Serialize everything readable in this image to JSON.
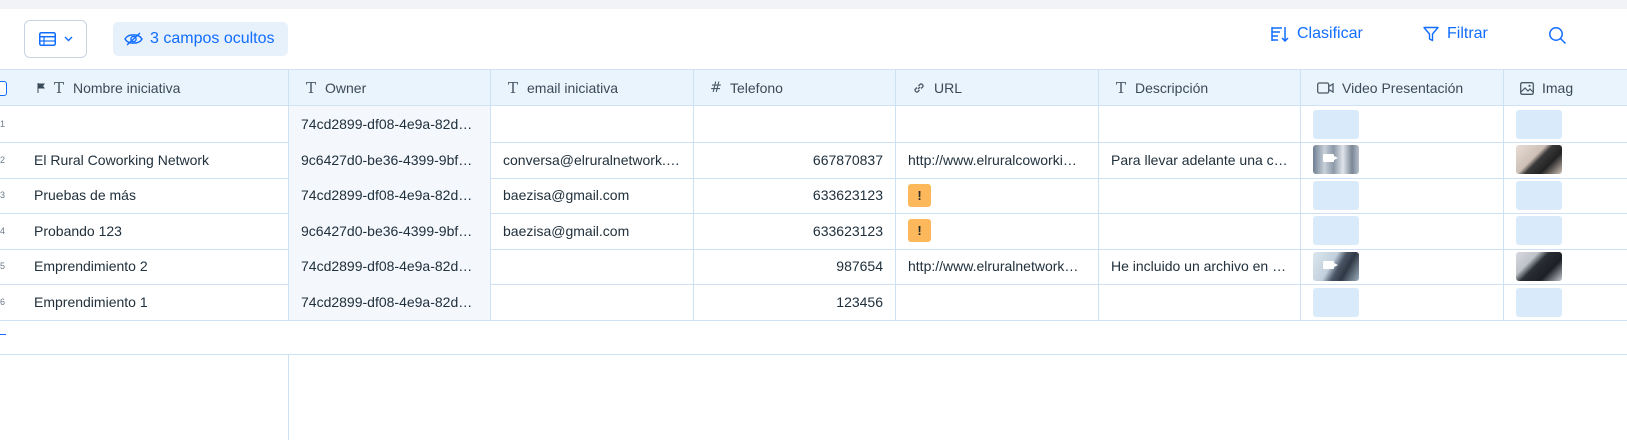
{
  "toolbar": {
    "view_icon": "table-view-icon",
    "hidden_fields_label": "3 campos ocultos",
    "sort_label": "Clasificar",
    "filter_label": "Filtrar",
    "accent_color": "#116dff"
  },
  "table": {
    "columns": [
      {
        "label": "Nombre iniciativa",
        "icon": "text-icon"
      },
      {
        "label": "Owner",
        "icon": "text-icon"
      },
      {
        "label": "email iniciativa",
        "icon": "text-icon"
      },
      {
        "label": "Telefono",
        "icon": "number-icon"
      },
      {
        "label": "URL",
        "icon": "link-icon"
      },
      {
        "label": "Descripción",
        "icon": "text-icon"
      },
      {
        "label": "Video Presentación",
        "icon": "video-icon"
      },
      {
        "label": "Imag",
        "icon": "image-icon"
      }
    ],
    "rows": [
      {
        "num": "1",
        "nombre": "",
        "owner": "74cd2899-df08-4e9a-82d…",
        "email": "",
        "telefono": "",
        "url": "",
        "descripcion": "",
        "video": "empty",
        "imagen": "empty"
      },
      {
        "num": "2",
        "nombre": "El Rural Coworking Network",
        "owner": "9c6427d0-be36-4399-9bf…",
        "email": "conversa@elruralnetwork.…",
        "telefono": "667870837",
        "url": "http://www.elruralcoworki…",
        "descripcion": "Para llevar adelante una c…",
        "video": "thumb",
        "imagen": "thumb"
      },
      {
        "num": "3",
        "nombre": "Pruebas de más",
        "owner": "74cd2899-df08-4e9a-82d…",
        "email": "baezisa@gmail.com",
        "telefono": "633623123",
        "url": "!",
        "descripcion": "",
        "video": "empty",
        "imagen": "empty"
      },
      {
        "num": "4",
        "nombre": "Probando 123",
        "owner": "9c6427d0-be36-4399-9bf…",
        "email": "baezisa@gmail.com",
        "telefono": "633623123",
        "url": "!",
        "descripcion": "",
        "video": "empty",
        "imagen": "empty"
      },
      {
        "num": "5",
        "nombre": "Emprendimiento 2",
        "owner": "74cd2899-df08-4e9a-82d…",
        "email": "",
        "telefono": "987654",
        "url": "http://www.elruralnetwork…",
        "descripcion": "He incluido un archivo en …",
        "video": "thumb",
        "imagen": "thumb"
      },
      {
        "num": "6",
        "nombre": "Emprendimiento 1",
        "owner": "74cd2899-df08-4e9a-82d…",
        "email": "",
        "telefono": "123456",
        "url": "",
        "descripcion": "",
        "video": "empty",
        "imagen": "empty"
      }
    ]
  }
}
